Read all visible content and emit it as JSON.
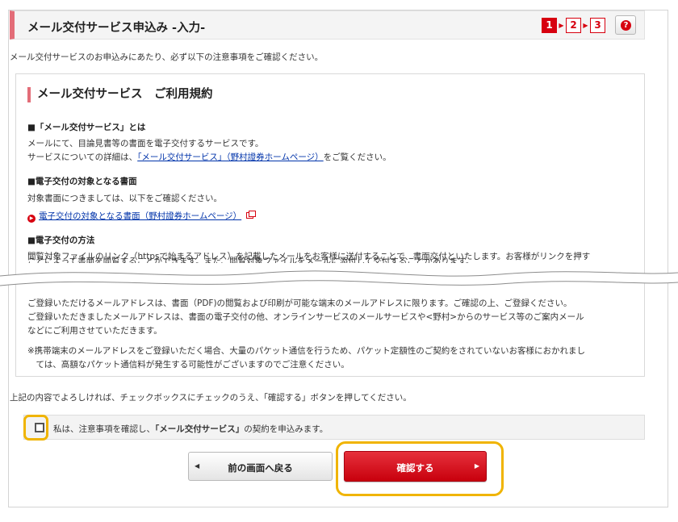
{
  "header": {
    "title": "メール交付サービス申込み -入力-",
    "steps": [
      "1",
      "2",
      "3"
    ],
    "active_step": 1,
    "help_icon": "?"
  },
  "intro_text": "メール交付サービスのお申込みにあたり、必ず以下の注意事項をご確認ください。",
  "terms": {
    "title": "メール交付サービス　ご利用規約",
    "section1": {
      "heading": "■「メール交付サービス」とは",
      "line1": "メールにて、目論見書等の書面を電子交付するサービスです。",
      "line2_prefix": "サービスについての詳細は、",
      "line2_link": "「メール交付サービス」（野村證券ホームページ）",
      "line2_suffix": "をご覧ください。"
    },
    "section2": {
      "heading": "■電子交付の対象となる書面",
      "line1": "対象書面につきましては、以下をご確認ください。",
      "link": "電子交付の対象となる書面（野村證券ホームページ）"
    },
    "section3": {
      "heading": "■電子交付の方法",
      "line1": "閲覧対象ファイルのリンク（httpsで始まるアドレス）を記載したメールをお客様に送付することで、書面交付といたします。お客様がリンクを押す",
      "line2_cut": "ことによって書面を閲覧することができます。また、閲覧対象ファイルをメールに添付して交付することがあります。"
    },
    "lower": {
      "line1": "ご登録いただけるメールアドレスは、書面（PDF)の閲覧および印刷が可能な端末のメールアドレスに限ります。ご確認の上、ご登録ください。",
      "line2": "ご登録いただきましたメールアドレスは、書面の電子交付の他、オンラインサービスのメールサービスや<野村>からのサービス等のご案内メール",
      "line3": "などにご利用させていただきます。",
      "line4": "※携帯端末のメールアドレスをご登録いただく場合、大量のパケット通信を行うため、パケット定額性のご契約をされていないお客様におかれまし",
      "line5": "　ては、高額なパケット通信料が発生する可能性がございますのでご注意ください。"
    }
  },
  "checkbox": {
    "instruction": "上記の内容でよろしければ、チェックボックスにチェックのうえ、「確認する」ボタンを押してください。",
    "label_prefix": "私は、注意事項を確認し、",
    "label_bold": "「メール交付サービス」",
    "label_suffix": "の契約を申込みます。",
    "checked": false
  },
  "buttons": {
    "back_label": "前の画面へ戻る",
    "confirm_label": "確認する"
  },
  "colors": {
    "accent_red": "#d7000f",
    "header_bar": "#e36d78",
    "highlight": "#f0b400",
    "link": "#0033aa"
  }
}
